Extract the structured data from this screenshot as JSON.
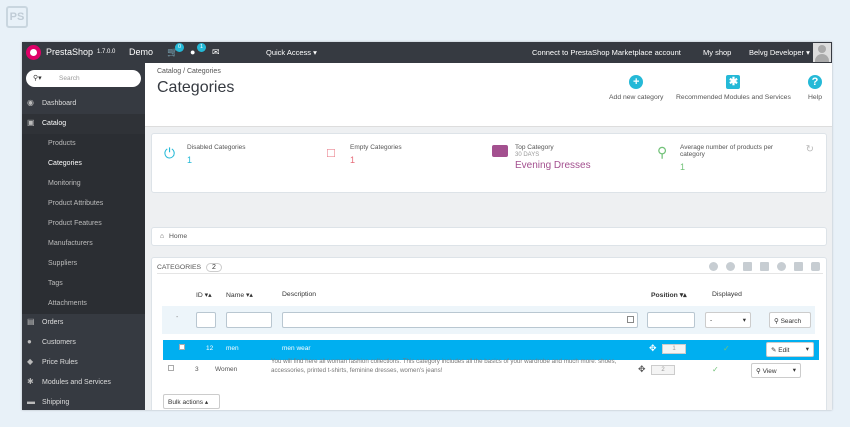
{
  "watermark": "PS",
  "topbar": {
    "brand": "PrestaShop",
    "version": "1.7.0.0",
    "shop": "Demo",
    "cart_badge": "0",
    "customer_badge": "1",
    "quick_access": "Quick Access ▾",
    "marketplace": "Connect to PrestaShop Marketplace account",
    "my_shop": "My shop",
    "user": "Belvg Developer ▾"
  },
  "sidebar": {
    "search_placeholder": "Search",
    "items": [
      {
        "label": "Dashboard",
        "icon": "dashboard-icon"
      },
      {
        "label": "Catalog",
        "icon": "catalog-icon"
      },
      {
        "label": "Orders",
        "icon": "orders-icon"
      },
      {
        "label": "Customers",
        "icon": "customers-icon"
      },
      {
        "label": "Price Rules",
        "icon": "tag-icon"
      },
      {
        "label": "Modules and Services",
        "icon": "puzzle-icon"
      },
      {
        "label": "Shipping",
        "icon": "truck-icon"
      }
    ],
    "submenu": [
      "Products",
      "Categories",
      "Monitoring",
      "Product Attributes",
      "Product Features",
      "Manufacturers",
      "Suppliers",
      "Tags",
      "Attachments"
    ]
  },
  "header": {
    "breadcrumb": "Catalog  /  Categories",
    "title": "Categories",
    "add_new": "Add new category",
    "recommended": "Recommended Modules and Services",
    "help": "Help"
  },
  "kpis": [
    {
      "label": "Disabled Categories",
      "value": "1"
    },
    {
      "label": "Empty Categories",
      "value": "1"
    },
    {
      "label": "Top Category",
      "sub": "30 DAYS",
      "value": "Evening Dresses"
    },
    {
      "label": "Average number of products per category",
      "value": "1"
    }
  ],
  "breadcrumb_home": "Home",
  "table": {
    "title": "CATEGORIES",
    "count": "2",
    "col_id": "ID ▾▴",
    "col_name": "Name ▾▴",
    "col_desc": "Description",
    "col_position": "Position ▾▴",
    "col_displayed": "Displayed",
    "filter_select": "-",
    "search_btn": "Search",
    "rows": [
      {
        "id": "12",
        "name": "men",
        "description": "men wear",
        "position": "1",
        "action": "Edit"
      },
      {
        "id": "3",
        "name": "Women",
        "description": "You will find here all woman fashion collections. This category includes all the basics of your wardrobe and much more: shoes, accessories, printed t-shirts, feminine dresses, women's jeans!",
        "position": "2",
        "action": "View"
      }
    ],
    "bulk_actions": "Bulk actions ▴"
  },
  "colors": {
    "accent": "#25b9d7",
    "sidebar": "#363a41",
    "selected_row": "#00aff0",
    "kpi_top": "#a3508f"
  }
}
